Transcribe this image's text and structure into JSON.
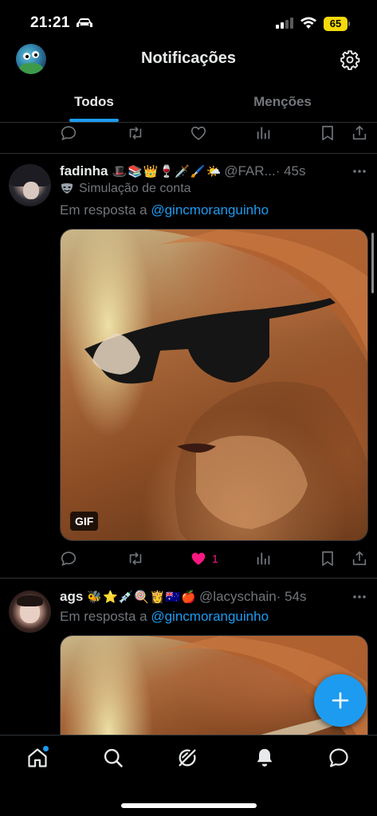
{
  "status_bar": {
    "time": "21:21",
    "battery": "65"
  },
  "header": {
    "title": "Notificações"
  },
  "tabs": [
    {
      "label": "Todos",
      "active": true
    },
    {
      "label": "Menções",
      "active": false
    }
  ],
  "tweets": [
    {
      "name": "fadinha",
      "emojis": "🎩📚👑🍷🗡️🖌️🌤️",
      "handle": "@FAR...",
      "time": "· 45s",
      "simulation_label": "Simulação de conta",
      "reply_prefix": "Em resposta a",
      "reply_to": "@gincmoranguinho",
      "media_badge": "GIF",
      "likes": "1"
    },
    {
      "name": "ags",
      "emojis": "🐝⭐💉🍭👸🇦🇺🍎",
      "handle": "@lacyschain",
      "time": "· 54s",
      "reply_prefix": "Em resposta a",
      "reply_to": "@gincmoranguinho"
    }
  ],
  "colors": {
    "accent": "#1d9bf0",
    "like": "#f91880",
    "muted": "#71767b",
    "background": "#000000"
  },
  "icons": {
    "bottom_nav": [
      "home-icon",
      "search-icon",
      "grok-icon",
      "notifications-bell-icon",
      "messages-icon"
    ],
    "tweet_actions": [
      "reply-icon",
      "retweet-icon",
      "like-icon",
      "views-icon",
      "bookmark-icon",
      "share-icon"
    ]
  }
}
